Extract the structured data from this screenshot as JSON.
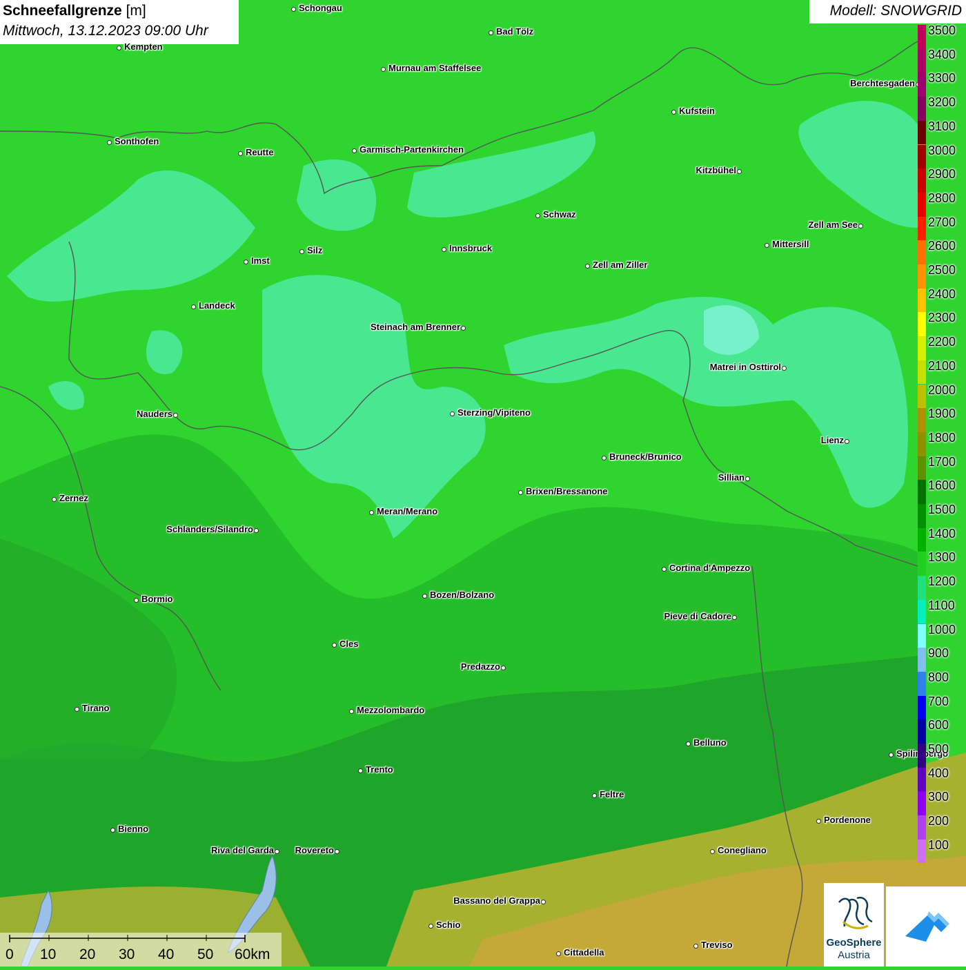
{
  "title": {
    "variable": "Schneefallgrenze",
    "unit": "[m]",
    "datetime": "Mittwoch, 13.12.2023 09:00 Uhr"
  },
  "model_label": "Modell: SNOWGRID",
  "legend": [
    {
      "label": "3500",
      "color": "#c0005a"
    },
    {
      "label": "3400",
      "color": "#b00065"
    },
    {
      "label": "3300",
      "color": "#a0006f"
    },
    {
      "label": "3200",
      "color": "#8a0060"
    },
    {
      "label": "3100",
      "color": "#6a0000"
    },
    {
      "label": "3000",
      "color": "#a00000"
    },
    {
      "label": "2900",
      "color": "#c80000"
    },
    {
      "label": "2800",
      "color": "#e80000"
    },
    {
      "label": "2700",
      "color": "#ff2000"
    },
    {
      "label": "2600",
      "color": "#ff7000"
    },
    {
      "label": "2500",
      "color": "#ff9000"
    },
    {
      "label": "2400",
      "color": "#ffc000"
    },
    {
      "label": "2300",
      "color": "#ffff00"
    },
    {
      "label": "2200",
      "color": "#d8f000"
    },
    {
      "label": "2100",
      "color": "#c8e000"
    },
    {
      "label": "2000",
      "color": "#c0c000"
    },
    {
      "label": "1900",
      "color": "#b09000"
    },
    {
      "label": "1800",
      "color": "#909000"
    },
    {
      "label": "1700",
      "color": "#609000"
    },
    {
      "label": "1600",
      "color": "#007000"
    },
    {
      "label": "1500",
      "color": "#009000"
    },
    {
      "label": "1400",
      "color": "#00b000"
    },
    {
      "label": "1300",
      "color": "#20d020"
    },
    {
      "label": "1200",
      "color": "#20e080"
    },
    {
      "label": "1100",
      "color": "#00f0c0"
    },
    {
      "label": "1000",
      "color": "#80ffff"
    },
    {
      "label": "900",
      "color": "#80c0f0"
    },
    {
      "label": "800",
      "color": "#3080f0"
    },
    {
      "label": "700",
      "color": "#0000f0"
    },
    {
      "label": "600",
      "color": "#0000a0"
    },
    {
      "label": "500",
      "color": "#300080"
    },
    {
      "label": "400",
      "color": "#6000c0"
    },
    {
      "label": "300",
      "color": "#9000f0"
    },
    {
      "label": "200",
      "color": "#b040f0"
    },
    {
      "label": "100",
      "color": "#d070f0"
    }
  ],
  "cities": [
    {
      "name": "Schongau",
      "side": "r"
    },
    {
      "name": "Kempten",
      "side": "r"
    },
    {
      "name": "Bad Tölz",
      "side": "r"
    },
    {
      "name": "Murnau am Staffelsee",
      "side": "r"
    },
    {
      "name": "Berchtesgaden",
      "side": "l"
    },
    {
      "name": "Kufstein",
      "side": "r"
    },
    {
      "name": "Sonthofen",
      "side": "r"
    },
    {
      "name": "Reutte",
      "side": "r"
    },
    {
      "name": "Garmisch-Partenkirchen",
      "side": "r"
    },
    {
      "name": "Kitzbühel",
      "side": "l"
    },
    {
      "name": "Schwaz",
      "side": "r"
    },
    {
      "name": "Zell am See",
      "side": "l"
    },
    {
      "name": "Innsbruck",
      "side": "r"
    },
    {
      "name": "Mittersill",
      "side": "r"
    },
    {
      "name": "Imst",
      "side": "r"
    },
    {
      "name": "Silz",
      "side": "r"
    },
    {
      "name": "Zell am Ziller",
      "side": "r"
    },
    {
      "name": "Landeck",
      "side": "r"
    },
    {
      "name": "Steinach am Brenner",
      "side": "l"
    },
    {
      "name": "Matrei in Osttirol",
      "side": "l"
    },
    {
      "name": "Nauders",
      "side": "l"
    },
    {
      "name": "Sterzing/Vipiteno",
      "side": "r"
    },
    {
      "name": "Lienz",
      "side": "l"
    },
    {
      "name": "Bruneck/Brunico",
      "side": "r"
    },
    {
      "name": "Sillian",
      "side": "l"
    },
    {
      "name": "Zernez",
      "side": "r"
    },
    {
      "name": "Brixen/Bressanone",
      "side": "r"
    },
    {
      "name": "Meran/Merano",
      "side": "r"
    },
    {
      "name": "Schlanders/Silandro",
      "side": "l"
    },
    {
      "name": "Cortina d'Ampezzo",
      "side": "r"
    },
    {
      "name": "Bozen/Bolzano",
      "side": "r"
    },
    {
      "name": "Bormio",
      "side": "r"
    },
    {
      "name": "Pieve di Cadore",
      "side": "l"
    },
    {
      "name": "Cles",
      "side": "r"
    },
    {
      "name": "Predazzo",
      "side": "l"
    },
    {
      "name": "Tirano",
      "side": "r"
    },
    {
      "name": "Mezzolombardo",
      "side": "r"
    },
    {
      "name": "Belluno",
      "side": "r"
    },
    {
      "name": "Spilimbergo",
      "side": "r"
    },
    {
      "name": "Trento",
      "side": "r"
    },
    {
      "name": "Feltre",
      "side": "r"
    },
    {
      "name": "Pordenone",
      "side": "r"
    },
    {
      "name": "Bienno",
      "side": "r"
    },
    {
      "name": "Riva del Garda",
      "side": "l"
    },
    {
      "name": "Rovereto",
      "side": "l"
    },
    {
      "name": "Conegliano",
      "side": "r"
    },
    {
      "name": "Bassano del Grappa",
      "side": "l"
    },
    {
      "name": "Schio",
      "side": "r"
    },
    {
      "name": "Treviso",
      "side": "r"
    },
    {
      "name": "Cittadella",
      "side": "r"
    }
  ],
  "scale": {
    "ticks": [
      "0",
      "10",
      "20",
      "30",
      "40",
      "50",
      "60km"
    ]
  },
  "logos": {
    "geosphere_line1": "GeoSphere",
    "geosphere_line2": "Austria",
    "app_icon": "snow-mountain-icon"
  }
}
